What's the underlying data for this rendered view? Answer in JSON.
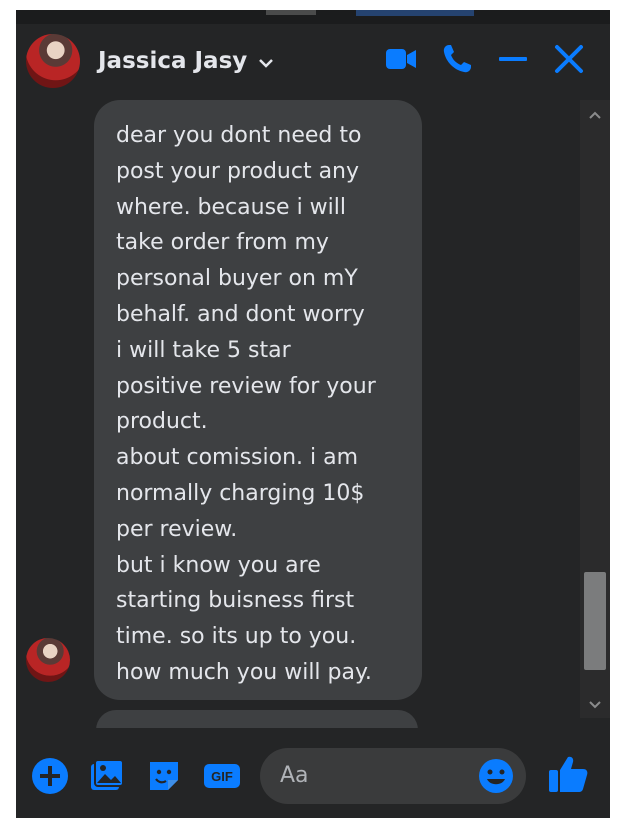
{
  "contact": {
    "name": "Jassica Jasy"
  },
  "header_icons": [
    "video-call-icon",
    "phone-call-icon",
    "minimize-icon",
    "close-icon"
  ],
  "message": {
    "text": "dear you dont need to\npost your product any\nwhere. because i will\ntake order from my\npersonal buyer on mY\nbehalf. and dont worry\ni will take 5 star\npositive review for your\nproduct.\nabout comission. i am\nnormally  charging 10$\nper review.\nbut i know you are\nstarting buisness first\ntime. so its up to you.\nhow much you will pay."
  },
  "composer": {
    "placeholder": "Aa",
    "icons": [
      "add-icon",
      "photo-icon",
      "sticker-icon",
      "gif-icon",
      "emoji-icon",
      "thumbs-up-icon"
    ],
    "gif_label": "GIF"
  },
  "colors": {
    "background": "#242526",
    "bubble": "#3e4042",
    "accent": "#0a7cff",
    "text": "#e4e6eb"
  }
}
